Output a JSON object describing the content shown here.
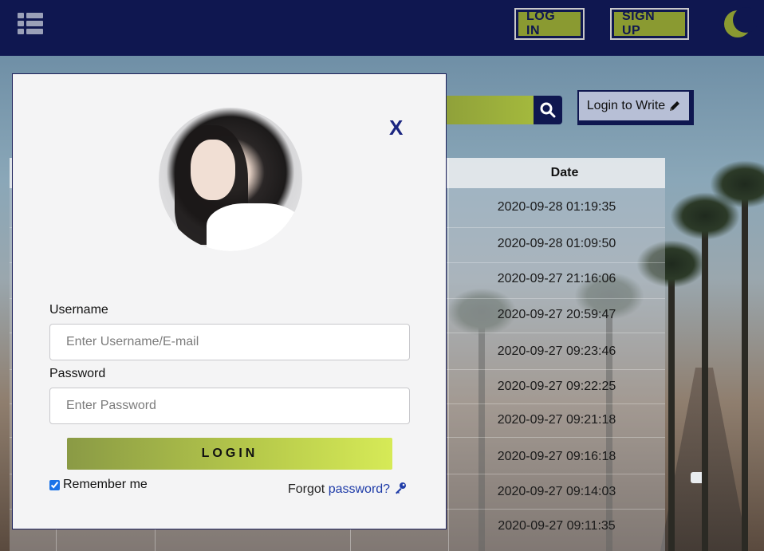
{
  "nav": {
    "login_label": "LOG IN",
    "signup_label": "SIGN UP",
    "menu_icon": "list-icon",
    "theme_icon": "moon-icon"
  },
  "toolbar": {
    "search_icon": "search-icon",
    "write_label": "Login to Write",
    "write_icon": "pencil-icon"
  },
  "table": {
    "date_header": "Date",
    "dates": [
      "2020-09-28 01:19:35",
      "2020-09-28 01:09:50",
      "2020-09-27 21:16:06",
      "2020-09-27 20:59:47",
      "2020-09-27 09:23:46",
      "2020-09-27 09:22:25",
      "2020-09-27 09:21:18",
      "2020-09-27 09:16:18",
      "2020-09-27 09:14:03",
      "2020-09-27 09:11:35"
    ]
  },
  "modal": {
    "close_label": "X",
    "username_label": "Username",
    "username_placeholder": "Enter Username/E-mail",
    "password_label": "Password",
    "password_placeholder": "Enter Password",
    "login_label": "LOGIN",
    "remember_label": "Remember me",
    "remember_checked": true,
    "forgot_prefix": "Forgot",
    "forgot_link": "password?",
    "forgot_icon": "key-icon"
  },
  "colors": {
    "nav_bg": "#0f1750",
    "accent": "#8a9a31",
    "link": "#1f3ca8"
  }
}
